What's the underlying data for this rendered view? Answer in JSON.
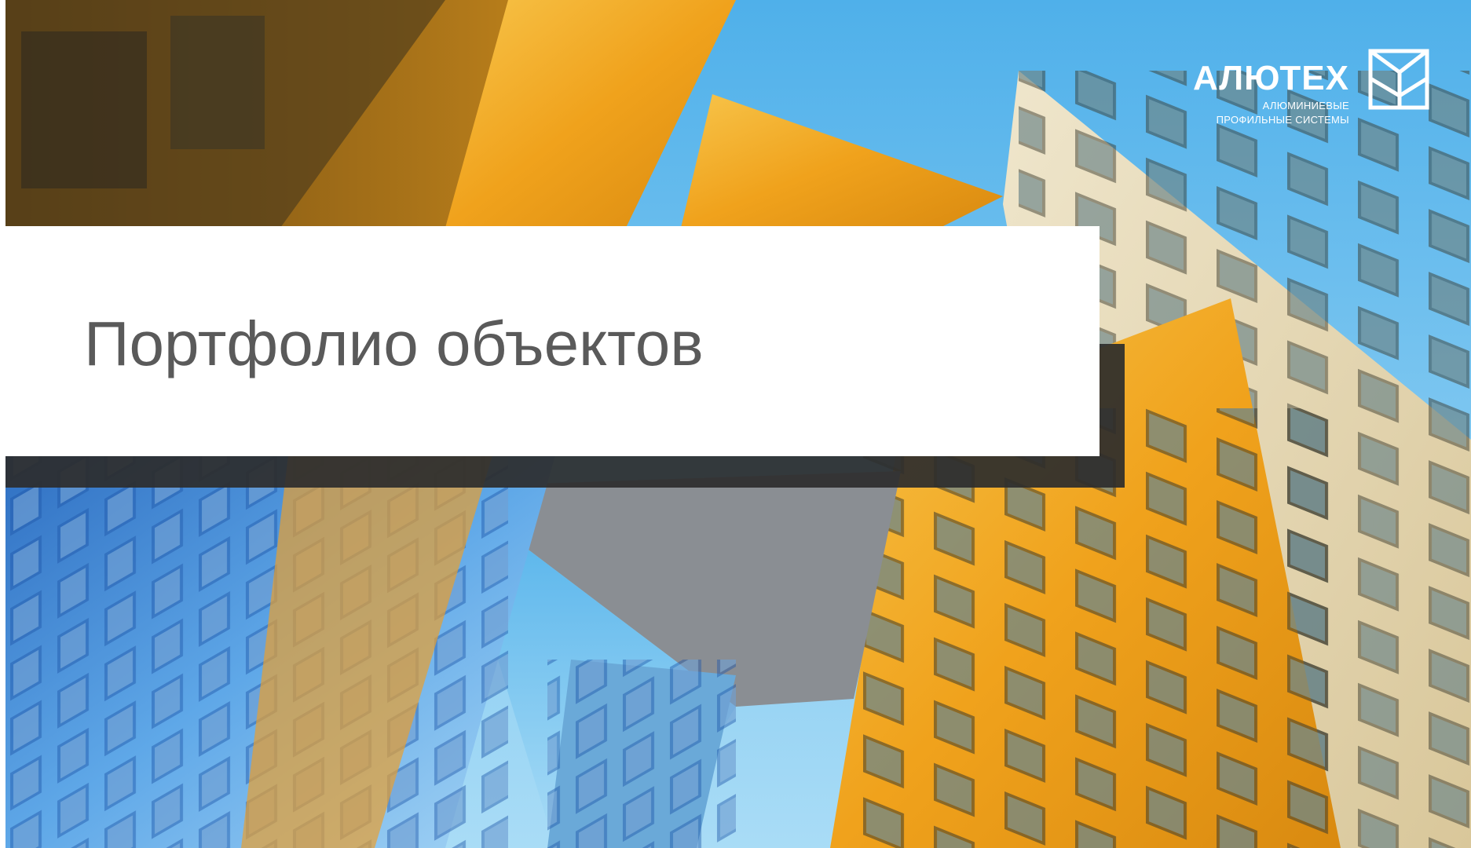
{
  "slide": {
    "title": "Портфолио объектов"
  },
  "logo": {
    "wordmark": "АЛЮТЕХ",
    "tagline_line1": "АЛЮМИНИЕВЫЕ",
    "tagline_line2": "ПРОФИЛЬНЫЕ СИСТЕМЫ",
    "icon": "alutech-mark-icon"
  },
  "colors": {
    "sky": "#5fb6e6",
    "facade_gold": "#f2a81e",
    "title_text": "#5a5a5a",
    "panel": "#ffffff",
    "shadow": "#2d2d2d"
  }
}
